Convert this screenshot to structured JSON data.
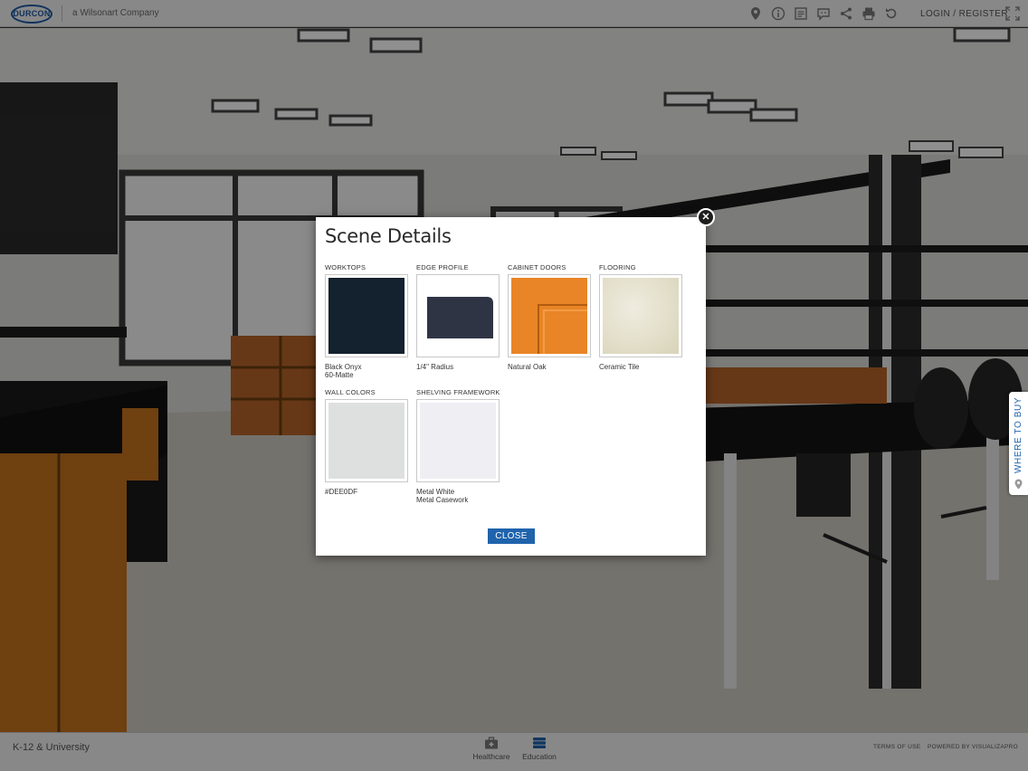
{
  "header": {
    "logo_text": "DURCON",
    "company": "a Wilsonart Company",
    "login_label": "LOGIN / REGISTER",
    "tools": [
      "location-icon",
      "info-icon",
      "document-icon",
      "chat-icon",
      "share-icon",
      "print-icon",
      "reset-icon"
    ]
  },
  "modal": {
    "title": "Scene Details",
    "items": [
      {
        "label": "WORKTOPS",
        "value_line1": "Black Onyx",
        "value_line2": "60-Matte",
        "color": "#14212e"
      },
      {
        "label": "EDGE PROFILE",
        "value_line1": "1/4\" Radius",
        "value_line2": "",
        "color": "#2f3444"
      },
      {
        "label": "CABINET DOORS",
        "value_line1": "Natural Oak",
        "value_line2": "",
        "color": "#e98526"
      },
      {
        "label": "FLOORING",
        "value_line1": "Ceramic Tile",
        "value_line2": "",
        "color": "#e6e2cf"
      },
      {
        "label": "WALL COLORS",
        "value_line1": "#DEE0DF",
        "value_line2": "",
        "color": "#dee0df"
      },
      {
        "label": "SHELVING FRAMEWORK",
        "value_line1": "Metal White",
        "value_line2": "Metal Casework",
        "color": "#eeeef3"
      }
    ],
    "close_label": "CLOSE"
  },
  "where_to_buy": "WHERE TO BUY",
  "footer": {
    "breadcrumb": "K-12 & University",
    "nav": [
      {
        "label": "Healthcare"
      },
      {
        "label": "Education"
      }
    ],
    "terms": "TERMS OF USE",
    "powered": "POWERED BY VISUALIZAPRO"
  },
  "colors": {
    "accent": "#1f63ac",
    "header_bg": "#f2f2f2"
  }
}
